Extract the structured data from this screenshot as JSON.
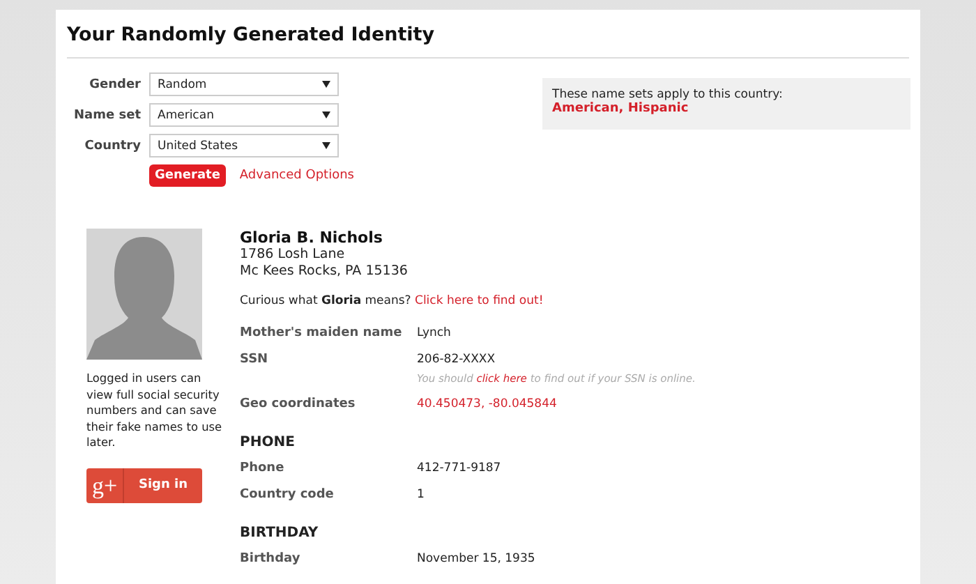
{
  "title": "Your Randomly Generated Identity",
  "form": {
    "fields": [
      {
        "label": "Gender",
        "value": "Random"
      },
      {
        "label": "Name set",
        "value": "American"
      },
      {
        "label": "Country",
        "value": "United States"
      }
    ],
    "generate_button": "Generate",
    "advanced_link": "Advanced Options"
  },
  "name_sets_note": {
    "text": "These name sets apply to this country:",
    "sets": "American, Hispanic"
  },
  "sidebar": {
    "login_note": "Logged in users can view full social security numbers and can save their fake names to use later.",
    "sign_in_button": {
      "logo": "g+",
      "label": "Sign in"
    }
  },
  "identity": {
    "name": "Gloria B. Nichols",
    "address_lines": [
      "1786 Losh Lane",
      "Mc Kees Rocks, PA 15136"
    ],
    "meaning": {
      "text": "Curious what **Gloria** means?",
      "link": "Click here to find out!"
    }
  },
  "sections": [
    {
      "rows": [
        {
          "label": "Mother's maiden name",
          "value": "Lynch",
          "kind": "text"
        },
        {
          "label": "SSN",
          "value": "206-82-XXXX",
          "kind": "text",
          "note": {
            "before": "You should",
            "link": "click here",
            "after": "to find out if your SSN is online."
          }
        },
        {
          "label": "Geo coordinates",
          "value": "40.450473, -80.045844",
          "kind": "link"
        }
      ]
    },
    {
      "heading": "PHONE",
      "rows": [
        {
          "label": "Phone",
          "value": "412-771-9187",
          "kind": "text"
        },
        {
          "label": "Country code",
          "value": "1",
          "kind": "text"
        }
      ]
    },
    {
      "heading": "BIRTHDAY",
      "rows": [
        {
          "label": "Birthday",
          "value": "November 15, 1935",
          "kind": "text"
        }
      ]
    }
  ]
}
